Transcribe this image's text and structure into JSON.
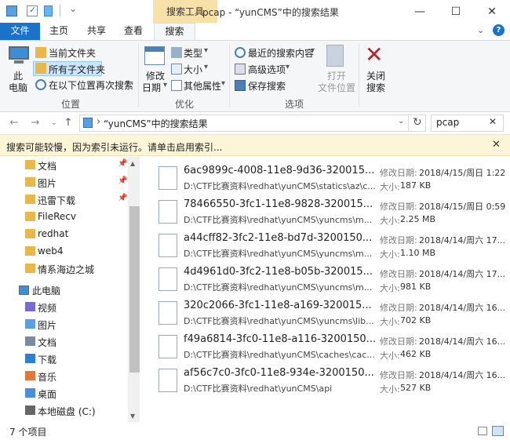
{
  "window": {
    "context_tab": "搜索工具",
    "title": "pcap - “yunCMS”中的搜索结果",
    "minimize": "—",
    "maximize": "☐",
    "close": "✕"
  },
  "tabs": {
    "file": "文件",
    "home": "主页",
    "share": "共享",
    "view": "查看",
    "search": "搜索"
  },
  "ribbon": {
    "this_pc": [
      "此",
      "电脑"
    ],
    "current_folder": "当前文件夹",
    "all_subfolders": "所有子文件夹",
    "search_again": "在以下位置再次搜索",
    "location_group": "位置",
    "modified_date": [
      "修改",
      "日期"
    ],
    "type": "类型",
    "size": "大小",
    "other_properties": "其他属性",
    "refine_group": "优化",
    "recent_searches": "最近的搜索内容",
    "advanced_options": "高级选项",
    "save_search": "保存搜索",
    "open_location": [
      "打开",
      "文件位置"
    ],
    "options_group": "选项",
    "close_search": [
      "关闭",
      "搜索"
    ]
  },
  "address": {
    "path": "“yunCMS”中的搜索结果",
    "search_value": "pcap",
    "chevron": "›"
  },
  "info_bar": {
    "text": "搜索可能较慢，因为索引未运行。请单击启用索引..."
  },
  "nav": {
    "quick_access": [
      {
        "label": "文档",
        "pinned": true
      },
      {
        "label": "图片",
        "pinned": true
      },
      {
        "label": "迅雷下载",
        "pinned": true
      },
      {
        "label": "FileRecv",
        "pinned": false
      },
      {
        "label": "redhat",
        "pinned": false
      },
      {
        "label": "web4",
        "pinned": false
      },
      {
        "label": "情系海边之城",
        "pinned": false
      }
    ],
    "this_pc": "此电脑",
    "pc_items": [
      "视频",
      "图片",
      "文档",
      "下载",
      "音乐",
      "桌面",
      "本地磁盘 (C:)"
    ]
  },
  "results": [
    {
      "name": "6ac9899c-4008-11e8-9d36-320015...",
      "path": "D:\\CTF比赛资料\\redhat\\yunCMS\\statics\\az\\c...",
      "modified": "2018/4/15/周日 1:22",
      "size": "187 KB"
    },
    {
      "name": "78466550-3fc1-11e8-9828-320015...",
      "path": "D:\\CTF比赛资料\\redhat\\yunCMS\\yuncms\\m...",
      "modified": "2018/4/15/周日 0:59",
      "size": "2.25 MB"
    },
    {
      "name": "a44cff82-3fc2-11e8-bd7d-3200150...",
      "path": "D:\\CTF比赛资料\\redhat\\yunCMS\\yuncms\\m...",
      "modified": "2018/4/14/周六 17...",
      "size": "1.10 MB"
    },
    {
      "name": "4d4961d0-3fc2-11e8-b05b-320015...",
      "path": "D:\\CTF比赛资料\\redhat\\yunCMS\\yuncms\\m...",
      "modified": "2018/4/14/周六 17...",
      "size": "981 KB"
    },
    {
      "name": "320c2066-3fc1-11e8-a169-320015...",
      "path": "D:\\CTF比赛资料\\redhat\\yunCMS\\yuncms\\lib...",
      "modified": "2018/4/14/周六 16...",
      "size": "702 KB"
    },
    {
      "name": "f49a6814-3fc0-11e8-a116-3200150...",
      "path": "D:\\CTF比赛资料\\redhat\\yunCMS\\caches\\cac...",
      "modified": "2018/4/14/周六 16...",
      "size": "462 KB"
    },
    {
      "name": "af56c7c0-3fc0-11e8-934e-3200150...",
      "path": "D:\\CTF比赛资料\\redhat\\yunCMS\\api",
      "modified": "2018/4/14/周六 16...",
      "size": "527 KB"
    }
  ],
  "labels": {
    "modified": "修改日期:",
    "size": "大小:"
  },
  "status": {
    "count": "7 个项目"
  },
  "colors": {
    "accent": "#1a73c9",
    "context_tab": "#f7e1a8",
    "folder": "#e8b84a",
    "info_bar": "#fcf5d8"
  }
}
